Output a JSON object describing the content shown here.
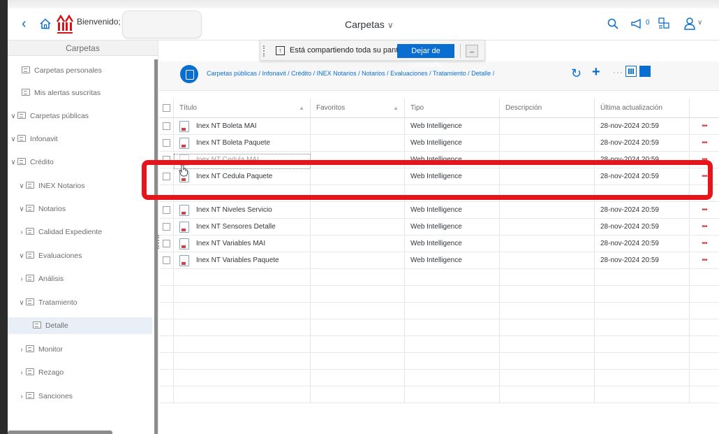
{
  "shell": {
    "welcome": "Bienvenido;",
    "title": "Carpetas",
    "notification_count": "0",
    "icons": [
      "back-icon",
      "home-icon",
      "search-icon",
      "megaphone-icon",
      "apps-icon",
      "user-icon"
    ]
  },
  "share_banner": {
    "message": "Está compartiendo toda su pantalla.",
    "stop_label": "Dejar de compartir",
    "minimize_label": "_"
  },
  "sidebar": {
    "heading": "Carpetas",
    "items": [
      {
        "label": "Carpetas personales",
        "chevron": "",
        "level": 0
      },
      {
        "label": "Mis alertas suscritas",
        "chevron": "",
        "level": 0
      },
      {
        "label": "Carpetas públicas",
        "chevron": "∨",
        "level": 0
      },
      {
        "label": "Infonavit",
        "chevron": "∨",
        "level": 0
      },
      {
        "label": "Crédito",
        "chevron": "∨",
        "level": 0
      },
      {
        "label": "INEX Notarios",
        "chevron": "∨",
        "level": 1
      },
      {
        "label": "Notarios",
        "chevron": "∨",
        "level": 1
      },
      {
        "label": "Calidad Expediente",
        "chevron": "›",
        "level": 1
      },
      {
        "label": "Evaluaciones",
        "chevron": "∨",
        "level": 1
      },
      {
        "label": "Análisis",
        "chevron": "›",
        "level": 1
      },
      {
        "label": "Tratamiento",
        "chevron": "∨",
        "level": 1
      },
      {
        "label": "Detalle",
        "chevron": "",
        "level": 2
      },
      {
        "label": "Monitor",
        "chevron": "›",
        "level": 1
      },
      {
        "label": "Rezago",
        "chevron": "›",
        "level": 1
      },
      {
        "label": "Sanciones",
        "chevron": "›",
        "level": 1
      }
    ]
  },
  "main": {
    "breadcrumb": "Carpetas públicas / Infonavit / Crédito / INEX Notarios / Notarios / Evaluaciones / Tratamiento / Detalle /",
    "columns": {
      "title": "Título",
      "favorites": "Favoritos",
      "type": "Tipo",
      "description": "Descripción",
      "updated": "Última actualización"
    },
    "rows": [
      {
        "title": "Inex NT Boleta MAI",
        "type": "Web Intelligence",
        "updated": "28-nov-2024 20:59",
        "actions": "•••"
      },
      {
        "title": "Inex NT Boleta Paquete",
        "type": "Web Intelligence",
        "updated": "28-nov-2024 20:59",
        "actions": "•••"
      },
      {
        "title": "Inex NT Cedula MAI",
        "type": "Web Intelligence",
        "updated": "28-nov-2024 20:59",
        "actions": "•••"
      },
      {
        "title": "Inex NT Cedula Paquete",
        "type": "Web Intelligence",
        "updated": "28-nov-2024 20:59",
        "actions": "•••"
      },
      {
        "title": "",
        "type": "",
        "updated": "",
        "actions": ""
      },
      {
        "title": "Inex NT Niveles Servicio",
        "type": "Web Intelligence",
        "updated": "28-nov-2024 20:59",
        "actions": "•••"
      },
      {
        "title": "Inex NT Sensores Detalle",
        "type": "Web Intelligence",
        "updated": "28-nov-2024 20:59",
        "actions": "•••"
      },
      {
        "title": "Inex NT Variables MAI",
        "type": "Web Intelligence",
        "updated": "28-nov-2024 20:59",
        "actions": "•••"
      },
      {
        "title": "Inex NT Variables Paquete",
        "type": "Web Intelligence",
        "updated": "28-nov-2024 20:59",
        "actions": "•••"
      }
    ]
  },
  "colors": {
    "accent": "#0a6ed1",
    "highlight": "#e8141b",
    "selected_bg": "#e8eff7"
  }
}
